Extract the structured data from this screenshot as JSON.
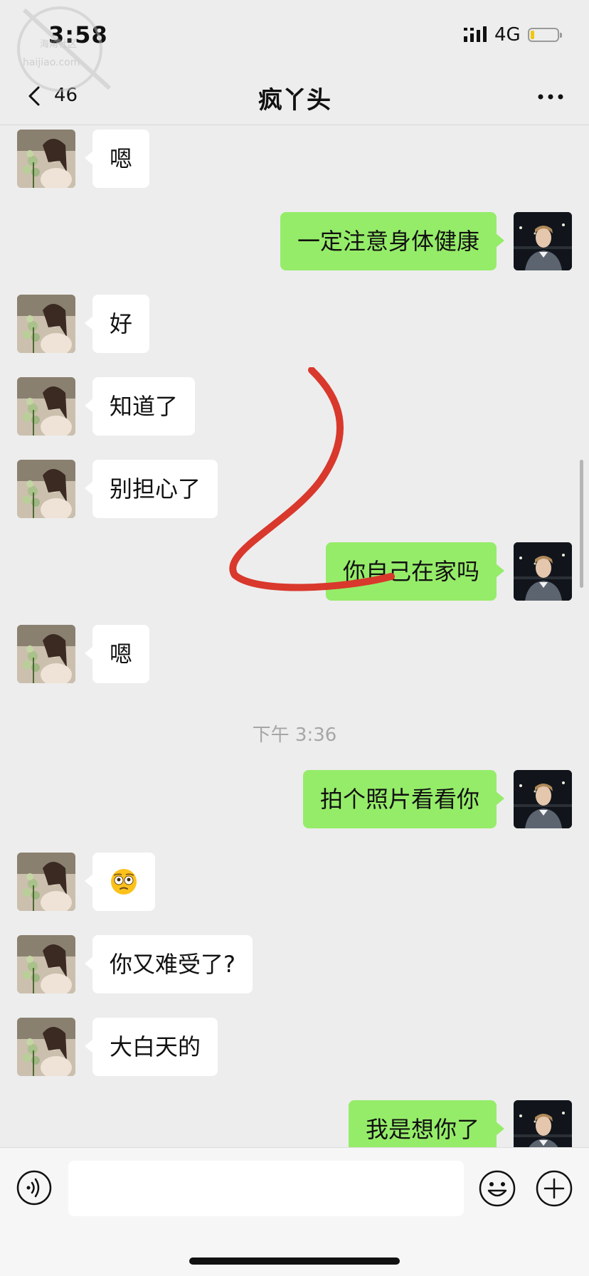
{
  "status_bar": {
    "time": "3:58",
    "network": "4G",
    "signal_icon": "signal-bars-icon",
    "battery_level": 0.15,
    "battery_color": "#f3c60e"
  },
  "nav": {
    "back_icon": "chevron-left-icon",
    "unread_count": "46",
    "title": "疯丫头",
    "more_icon": "more-dots-icon"
  },
  "chat": {
    "messages": [
      {
        "side": "left",
        "text": "嗯"
      },
      {
        "side": "right",
        "text": "一定注意身体健康"
      },
      {
        "side": "left",
        "text": "好"
      },
      {
        "side": "left",
        "text": "知道了"
      },
      {
        "side": "left",
        "text": "别担心了"
      },
      {
        "side": "right",
        "text": "你自己在家吗"
      },
      {
        "side": "left",
        "text": "嗯"
      },
      {
        "side": "right",
        "text": "拍个照片看看你"
      },
      {
        "side": "left",
        "emoji": "flushed-face-emoji"
      },
      {
        "side": "left",
        "text": "你又难受了?"
      },
      {
        "side": "left",
        "text": "大白天的"
      },
      {
        "side": "right",
        "text": "我是想你了"
      }
    ],
    "timestamp": "下午 3:36",
    "bubble_colors": {
      "incoming": "#ffffff",
      "outgoing": "#95ec69"
    },
    "annotation_color": "#d9382c"
  },
  "input_bar": {
    "voice_icon": "voice-input-icon",
    "message_value": "",
    "emoji_icon": "emoji-icon",
    "plus_icon": "plus-icon"
  },
  "watermark": {
    "text": "haijiao.com",
    "label": "海角社区"
  }
}
